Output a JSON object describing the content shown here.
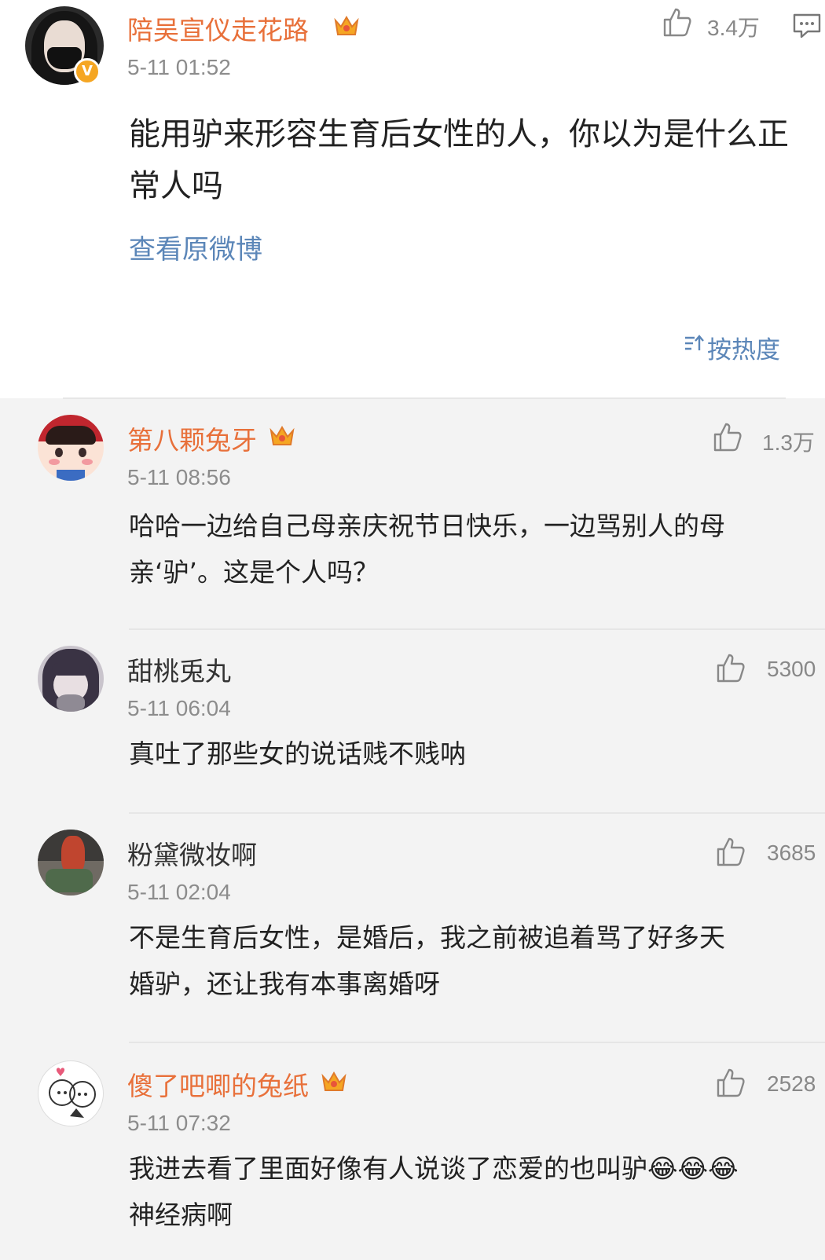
{
  "main_comment": {
    "username": "陪吴宣仪走花路",
    "timestamp": "5-11 01:52",
    "likes": "3.4万",
    "content_lines": [
      "能用驴来形容生育后女性的人，你以为是什么正",
      "常人吗"
    ],
    "view_original": "查看原微博",
    "verified_mark": "V"
  },
  "sort": {
    "label": "按热度"
  },
  "replies": [
    {
      "username": "第八颗兔牙",
      "timestamp": "5-11 08:56",
      "likes": "1.3万",
      "content_lines": [
        "哈哈一边给自己母亲庆祝节日快乐，一边骂别人的母",
        "亲‘驴’。这是个人吗？"
      ]
    },
    {
      "username": "甜桃兎丸",
      "timestamp": "5-11 06:04",
      "likes": "5300",
      "content_lines": [
        "真吐了那些女的说话贱不贱呐"
      ]
    },
    {
      "username": "粉黛微妆啊",
      "timestamp": "5-11 02:04",
      "likes": "3685",
      "content_lines": [
        "不是生育后女性，是婚后，我之前被追着骂了好多天",
        "婚驴，还让我有本事离婚呀"
      ]
    },
    {
      "username": "傻了吧唧的兔纸",
      "timestamp": "5-11 07:32",
      "likes": "2528",
      "content_lines": [
        "我进去看了里面好像有人说谈了恋爱的也叫驴😂😂😂",
        "神经病啊"
      ]
    }
  ],
  "colors": {
    "username": "#e8703a",
    "link": "#5b86b8",
    "crown": "#f5a623"
  }
}
